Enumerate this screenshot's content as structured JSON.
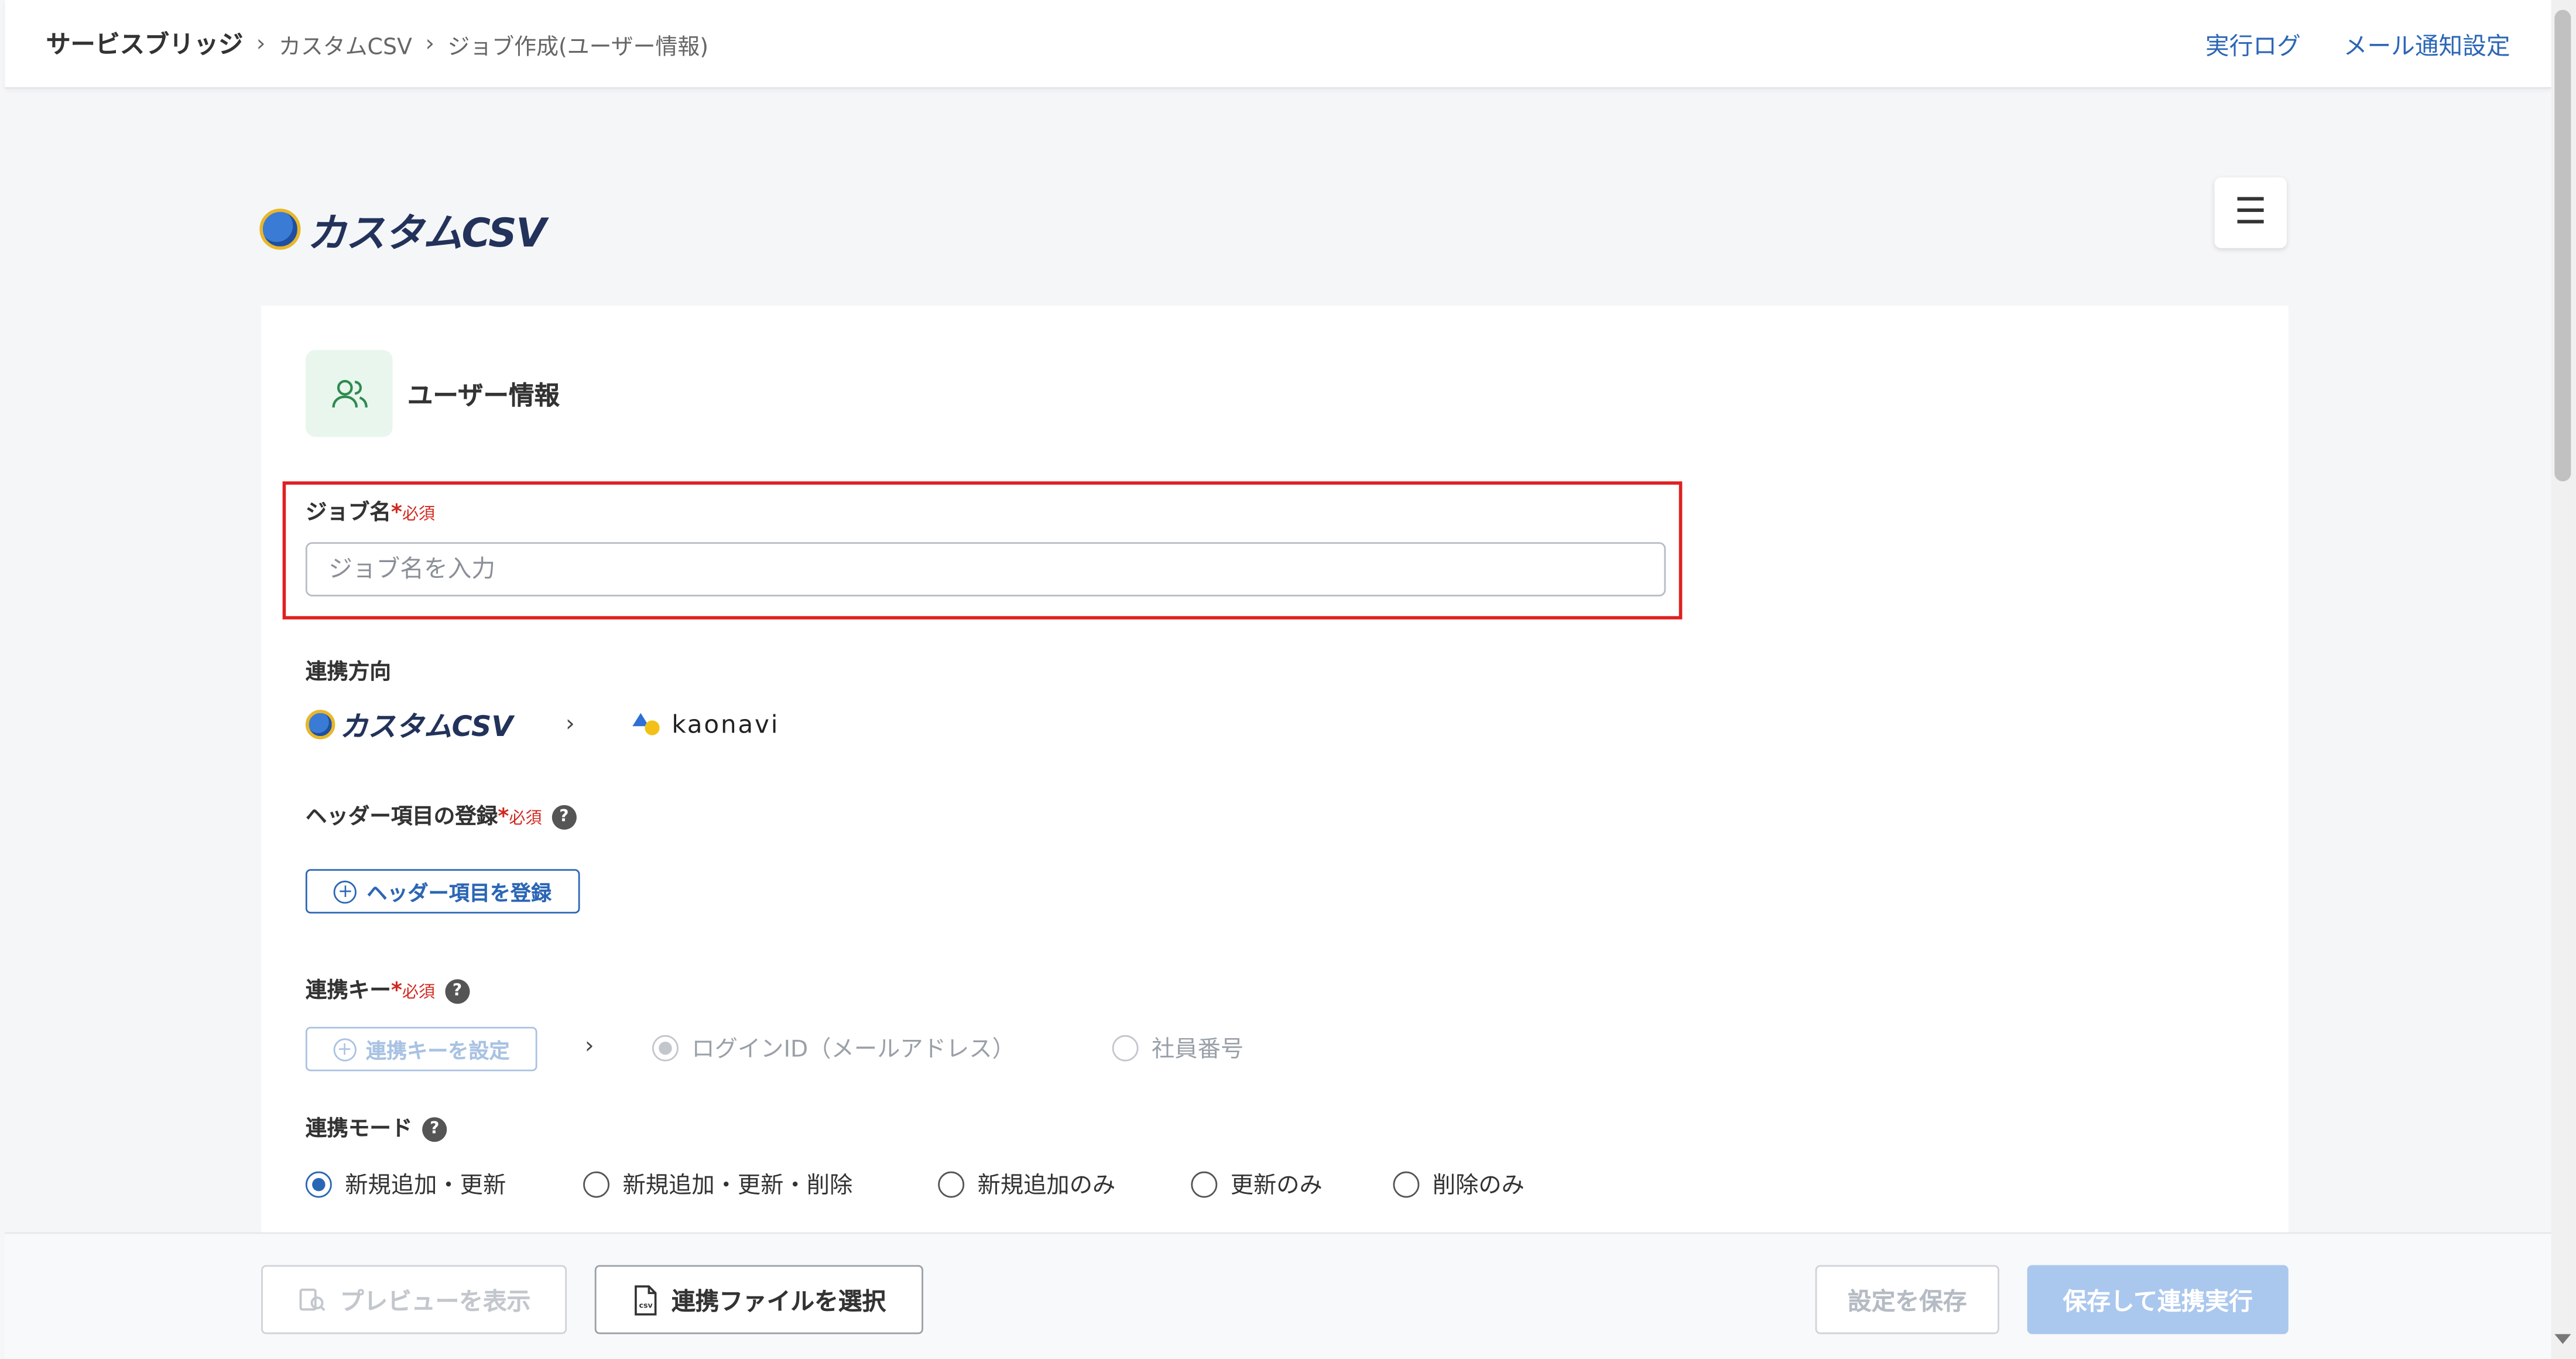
{
  "header": {
    "breadcrumbs": [
      "サービスブリッジ",
      "カスタムCSV",
      "ジョブ作成(ユーザー情報)"
    ],
    "links": [
      "実行ログ",
      "メール通知設定"
    ]
  },
  "brand": {
    "name": "カスタムCSV",
    "menu_icon": "hamburger-icon"
  },
  "section": {
    "title": "ユーザー情報",
    "icon": "users-icon"
  },
  "form": {
    "job_name": {
      "label": "ジョブ名",
      "required_mark": "*",
      "required_text": "必須",
      "placeholder": "ジョブ名を入力",
      "value": ""
    },
    "direction": {
      "label": "連携方向",
      "source": "カスタムCSV",
      "arrow": "›",
      "target": "kaonavi"
    },
    "header_items": {
      "label": "ヘッダー項目の登録",
      "required_mark": "*",
      "required_text": "必須",
      "help": "?",
      "button": "ヘッダー項目を登録"
    },
    "key": {
      "label": "連携キー",
      "required_mark": "*",
      "required_text": "必須",
      "help": "?",
      "button": "連携キーを設定",
      "arrow": "›",
      "options": [
        {
          "label": "ログインID（メールアドレス）",
          "selected": true
        },
        {
          "label": "社員番号",
          "selected": false
        }
      ]
    },
    "mode": {
      "label": "連携モード",
      "help": "?",
      "options": [
        {
          "label": "新規追加・更新",
          "selected": true
        },
        {
          "label": "新規追加・更新・削除",
          "selected": false
        },
        {
          "label": "新規追加のみ",
          "selected": false
        },
        {
          "label": "更新のみ",
          "selected": false
        },
        {
          "label": "削除のみ",
          "selected": false
        }
      ]
    }
  },
  "footer": {
    "preview": "プレビューを表示",
    "select_file": "連携ファイルを選択",
    "save": "設定を保存",
    "save_run": "保存して連携実行"
  },
  "colors": {
    "accent": "#2b66b5",
    "required": "#d0281f",
    "highlight": "#e02020",
    "run_disabled": "#aac7ee"
  }
}
